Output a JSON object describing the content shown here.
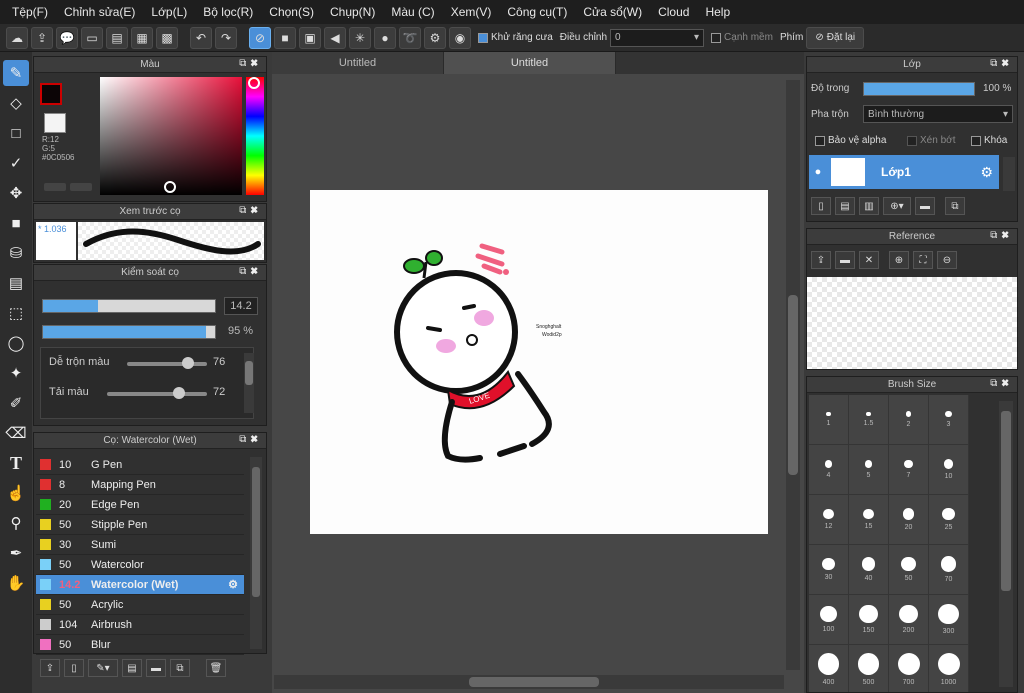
{
  "menu": [
    "Tệp(F)",
    "Chỉnh sửa(E)",
    "Lớp(L)",
    "Bộ lọc(R)",
    "Chọn(S)",
    "Chụp(N)",
    "Màu (C)",
    "Xem(V)",
    "Công cụ(T)",
    "Cửa sổ(W)",
    "Cloud",
    "Help"
  ],
  "toolbar": {
    "antialias_label": "Khử răng cưa",
    "adjust_label": "Điều chỉnh",
    "adjust_value": "0",
    "snap_label": "Cạnh mềm",
    "keys_label": "Phím",
    "reset_label": "Đặt lại"
  },
  "color_panel": {
    "title": "Màu",
    "r": "R:12",
    "g": "G:5",
    "hex": "#0C0506"
  },
  "preview_panel": {
    "title": "Xem trước cọ",
    "size": "1.036"
  },
  "control_panel": {
    "title": "Kiểm soát cọ",
    "size_value": "14.2",
    "opacity_value": "95 %",
    "size_fill": 0.32,
    "opacity_fill": 0.95,
    "blend_label": "Dễ trộn màu",
    "blend_value": "76",
    "blend_level": 0.76,
    "reload_label": "Tải màu",
    "reload_value": "72",
    "reload_level": 0.72
  },
  "brush_panel": {
    "title": "Cọ: Watercolor (Wet)",
    "brushes": [
      {
        "num": "10",
        "name": "G Pen",
        "color": "#e03030"
      },
      {
        "num": "8",
        "name": "Mapping Pen",
        "color": "#e03030"
      },
      {
        "num": "20",
        "name": "Edge Pen",
        "color": "#20b020"
      },
      {
        "num": "50",
        "name": "Stipple Pen",
        "color": "#e8d020"
      },
      {
        "num": "30",
        "name": "Sumi",
        "color": "#e8d020"
      },
      {
        "num": "50",
        "name": "Watercolor",
        "color": "#7ad0f8"
      },
      {
        "num": "14.2",
        "name": "Watercolor (Wet)",
        "color": "#7ad0f8"
      },
      {
        "num": "50",
        "name": "Acrylic",
        "color": "#e8d020"
      },
      {
        "num": "104",
        "name": "Airbrush",
        "color": "#cccccc"
      },
      {
        "num": "50",
        "name": "Blur",
        "color": "#f070c0"
      }
    ]
  },
  "canvas": {
    "tabs": [
      "Untitled",
      "Untitled"
    ],
    "small_text_1": "Snoghghalt",
    "small_text_2": "Wodid2p",
    "scarf_text": "LOVE"
  },
  "layer_panel": {
    "title": "Lớp",
    "opacity_label": "Độ trong",
    "opacity_value": "100 %",
    "opacity_level": 1.0,
    "blend_label": "Pha trộn",
    "blend_value": "Bình thường",
    "protect_alpha": "Bảo vệ alpha",
    "clipping": "Xén bớt",
    "lock": "Khóa",
    "layer_name": "Lớp1"
  },
  "reference_panel": {
    "title": "Reference"
  },
  "brushsize_panel": {
    "title": "Brush Size",
    "sizes": [
      "1",
      "1.5",
      "2",
      "3",
      "4",
      "5",
      "7",
      "10",
      "12",
      "15",
      "20",
      "25",
      "30",
      "40",
      "50",
      "70",
      "100",
      "150",
      "200",
      "300",
      "400",
      "500",
      "700",
      "1000"
    ]
  },
  "colors": {
    "accent": "#4a8fd8",
    "panel": "#303030",
    "canvas_bg": "#474747"
  }
}
